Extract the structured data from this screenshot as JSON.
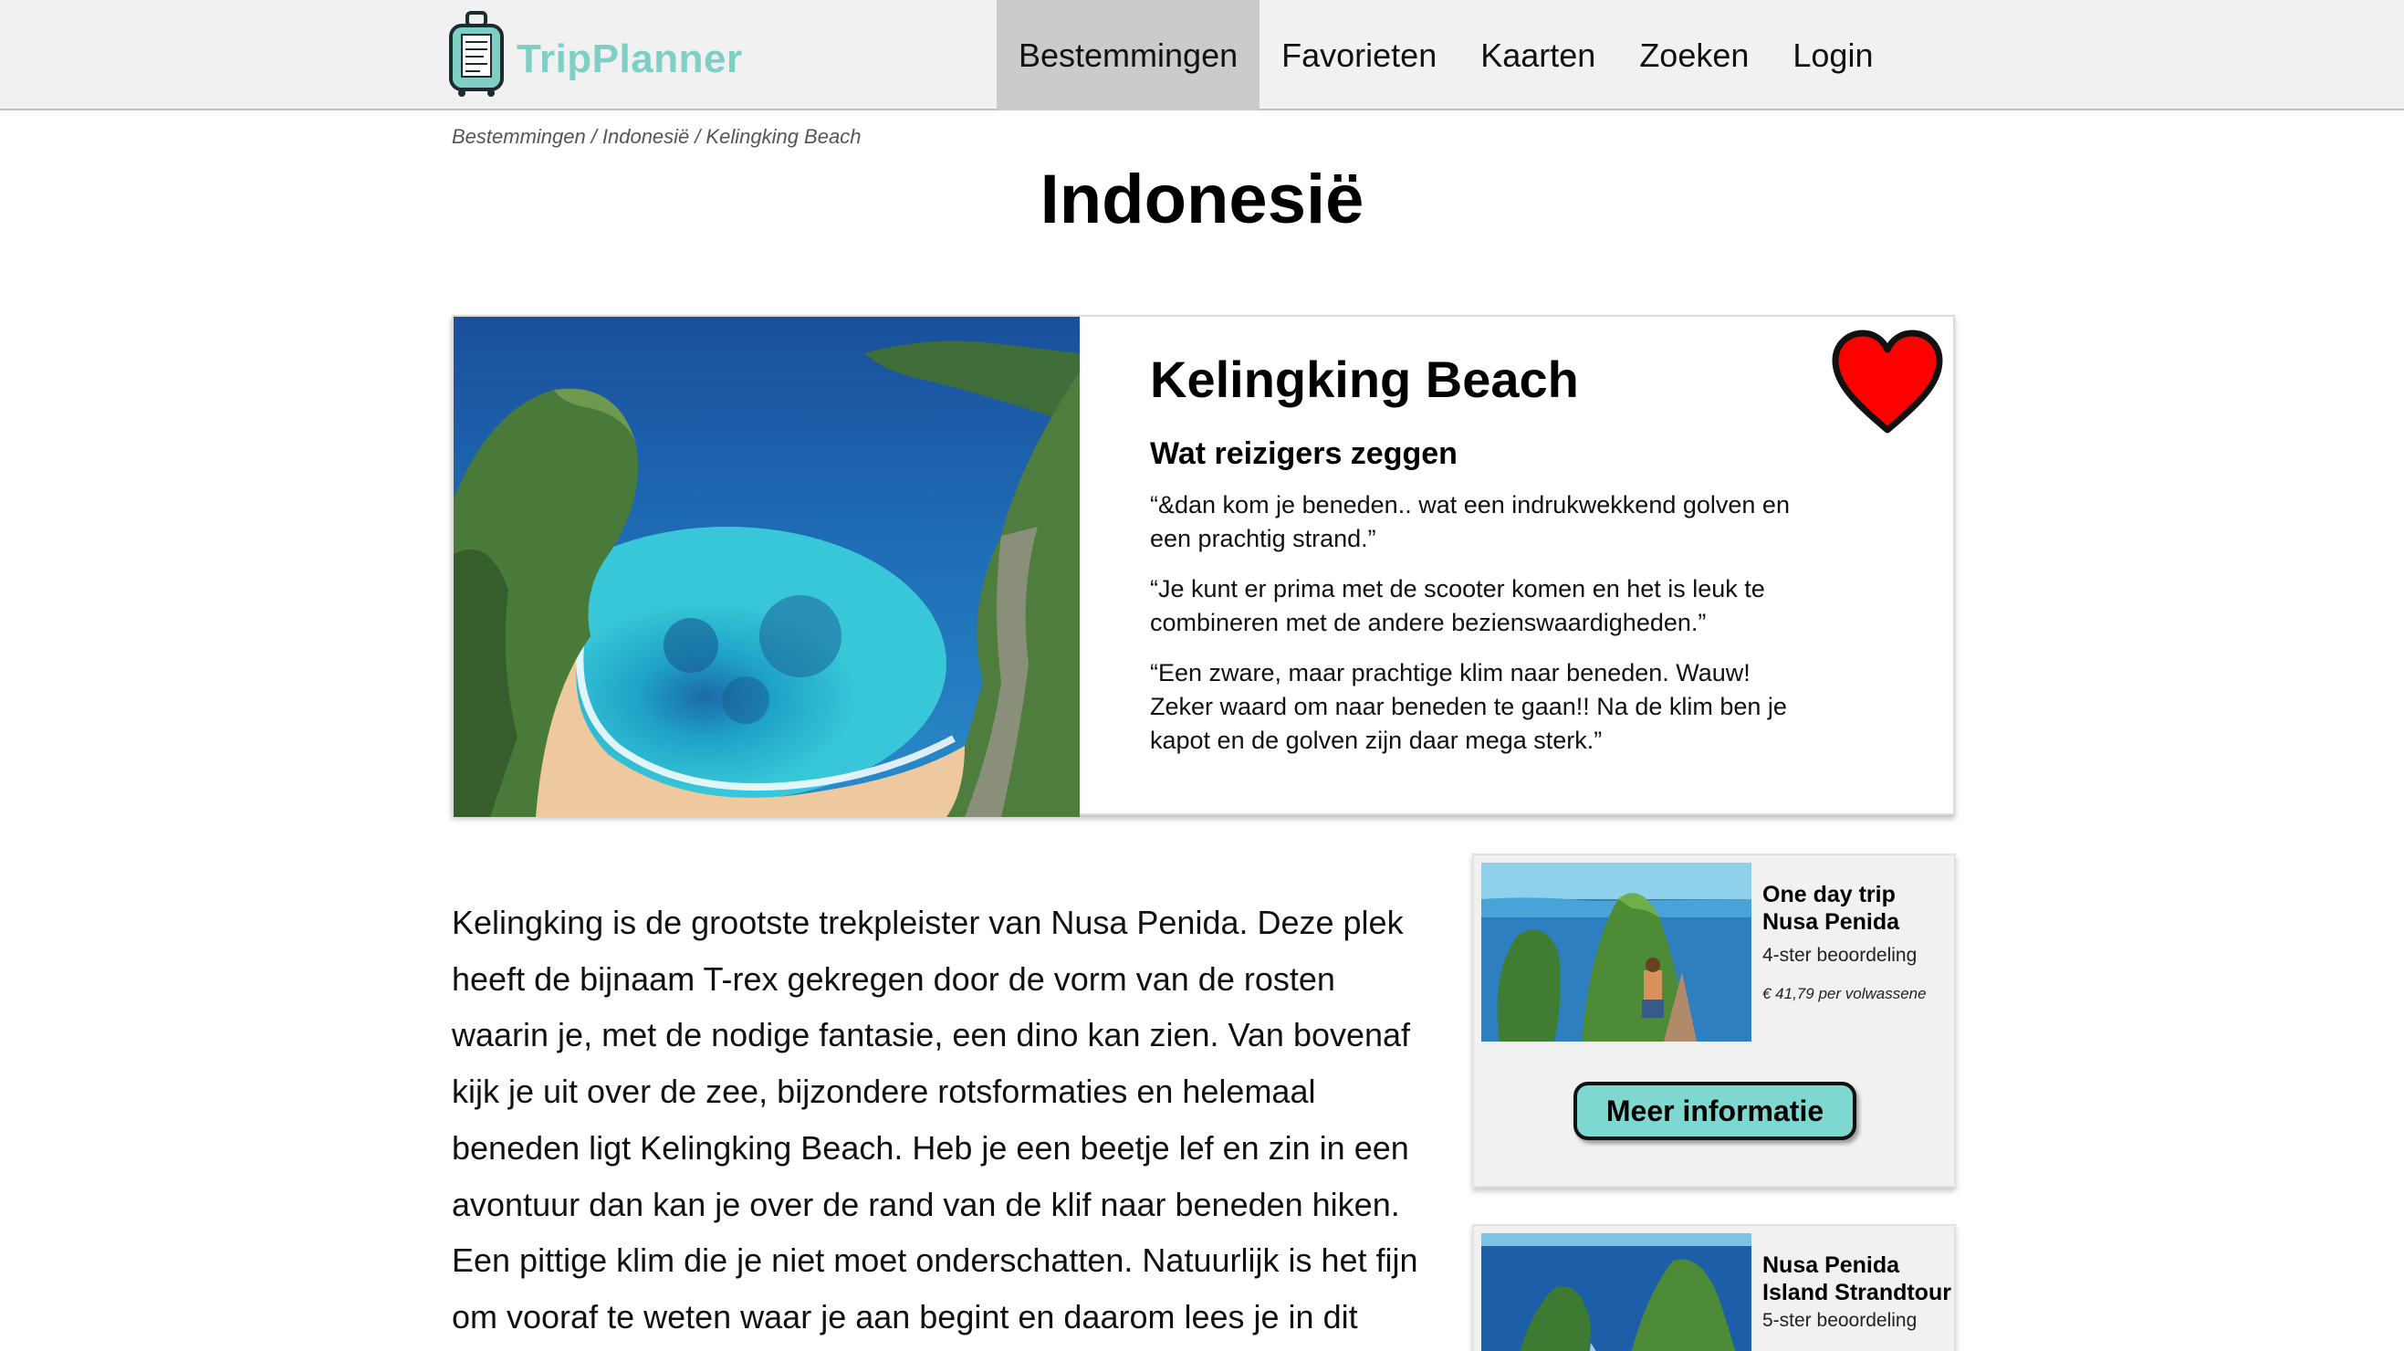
{
  "brand": {
    "name": "TripPlanner",
    "accent": "#7ecfc6"
  },
  "nav": {
    "items": [
      {
        "label": "Bestemmingen",
        "active": true
      },
      {
        "label": "Favorieten",
        "active": false
      },
      {
        "label": "Kaarten",
        "active": false
      },
      {
        "label": "Zoeken",
        "active": false
      },
      {
        "label": "Login",
        "active": false
      }
    ]
  },
  "breadcrumb": {
    "items": [
      "Bestemmingen",
      "Indonesië",
      "Kelingking Beach"
    ],
    "separator": "/"
  },
  "page": {
    "title": "Indonesië"
  },
  "feature": {
    "title": "Kelingking Beach",
    "image_alt": "kelingking-beach-photo",
    "favorite_icon": "heart-icon",
    "favorite_color": "#ff0000",
    "reviews_heading": "Wat reizigers zeggen",
    "reviews": [
      "“&dan kom je beneden.. wat een indrukwekkend golven en een prachtig strand.”",
      "“Je kunt er prima met de scooter komen en het is leuk te combineren met de andere bezienswaardigheden.”",
      "“Een zware, maar prachtige klim naar beneden. Wauw! Zeker waard om naar beneden te gaan!! Na de klim ben je kapot en de golven zijn daar mega sterk.”"
    ]
  },
  "article": {
    "text": "Kelingking is de grootste trekpleister van Nusa Penida. Deze plek heeft de bijnaam T-rex gekregen door de vorm van de rosten waarin je, met de nodige fantasie, een dino kan zien. Van bovenaf kijk je uit over de zee, bijzondere rotsformaties en helemaal beneden ligt Kelingking Beach. Heb je een beetje lef en zin in een avontuur dan kan je over de rand van de klif naar beneden hiken. Een pittige klim die je niet moet onderschatten. Natuurlijk is het fijn om vooraf te weten waar je aan begint en daarom lees je in dit"
  },
  "tours": [
    {
      "title": "One day trip Nusa Penida",
      "rating": "4-ster beoordeling",
      "price": "€ 41,79 per volwassene",
      "button_label": "Meer informatie"
    },
    {
      "title": "Nusa Penida Island Strandtour",
      "rating": "5-ster beoordeling"
    }
  ],
  "colors": {
    "button": "#7fd8cf",
    "nav_active": "#cbcbcb",
    "header_bg": "#f1f1f1"
  }
}
